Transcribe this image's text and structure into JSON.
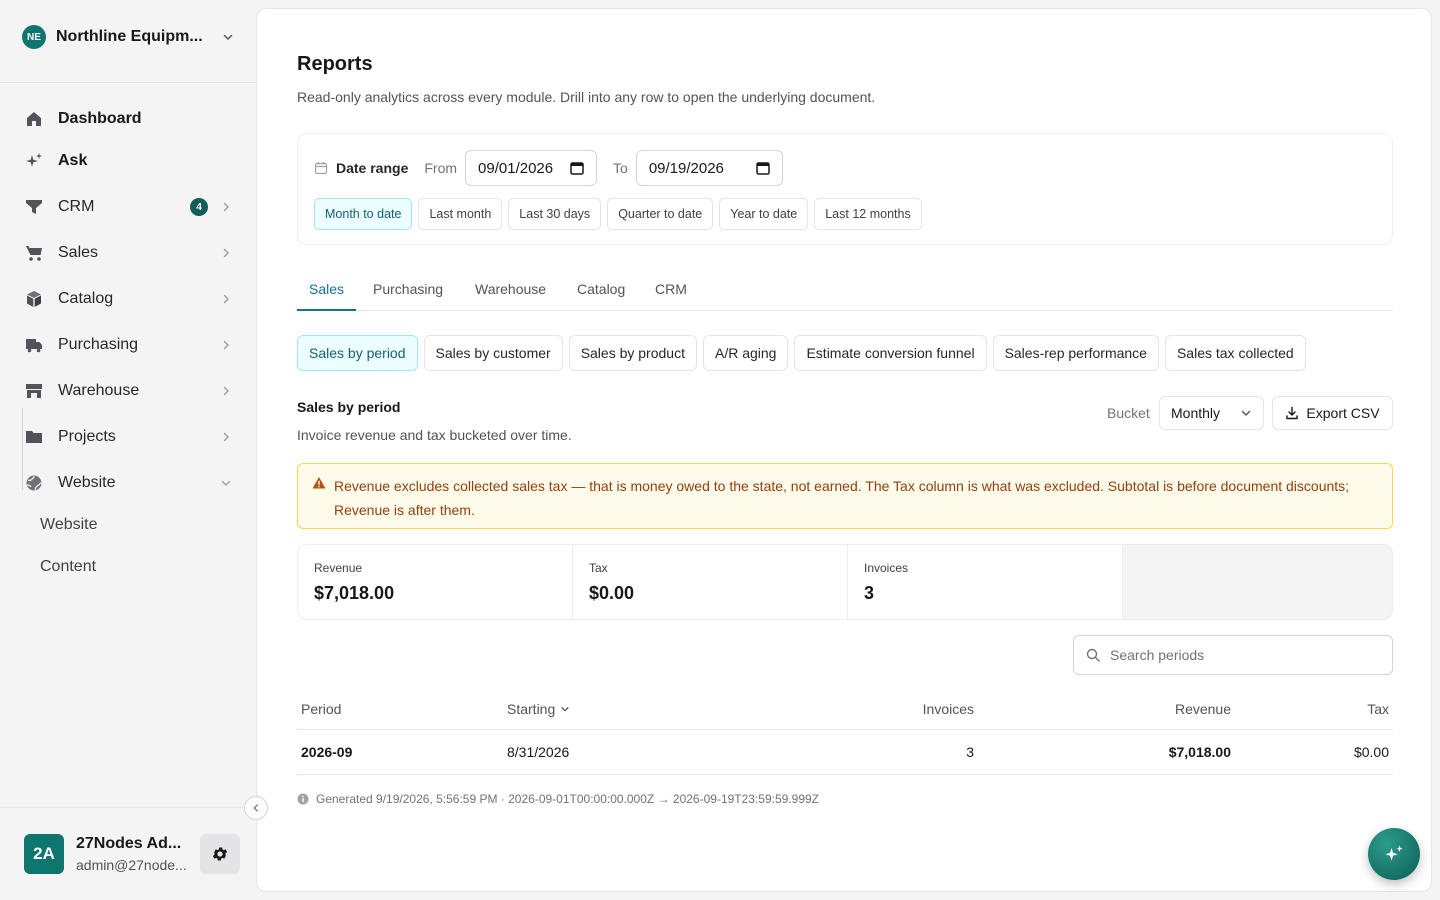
{
  "org": {
    "badge": "NE",
    "name": "Northline Equipm..."
  },
  "nav": {
    "dashboard": "Dashboard",
    "ask": "Ask",
    "crm": "CRM",
    "crm_badge": "4",
    "sales": "Sales",
    "catalog": "Catalog",
    "purchasing": "Purchasing",
    "warehouse": "Warehouse",
    "projects": "Projects",
    "website": "Website",
    "website_sub": [
      "Website",
      "Content"
    ]
  },
  "user": {
    "initials": "2A",
    "name": "27Nodes Ad...",
    "email": "admin@27node..."
  },
  "page": {
    "title": "Reports",
    "subtitle": "Read-only analytics across every module. Drill into any row to open the underlying document."
  },
  "daterange": {
    "label": "Date range",
    "from_label": "From",
    "from_value": "09/01/2026",
    "to_label": "To",
    "to_value": "09/19/2026",
    "presets": [
      "Month to date",
      "Last month",
      "Last 30 days",
      "Quarter to date",
      "Year to date",
      "Last 12 months"
    ]
  },
  "tabs": [
    "Sales",
    "Purchasing",
    "Warehouse",
    "Catalog",
    "CRM"
  ],
  "report_types": [
    "Sales by period",
    "Sales by customer",
    "Sales by product",
    "A/R aging",
    "Estimate conversion funnel",
    "Sales-rep performance",
    "Sales tax collected"
  ],
  "section": {
    "title": "Sales by period",
    "subtitle": "Invoice revenue and tax bucketed over time.",
    "bucket_label": "Bucket",
    "bucket_value": "Monthly",
    "export_label": "Export CSV"
  },
  "warning": "Revenue excludes collected sales tax — that is money owed to the state, not earned. The Tax column is what was excluded. Subtotal is before document discounts; Revenue is after them.",
  "stats": [
    {
      "label": "Revenue",
      "value": "$7,018.00"
    },
    {
      "label": "Tax",
      "value": "$0.00"
    },
    {
      "label": "Invoices",
      "value": "3"
    }
  ],
  "search": {
    "placeholder": "Search periods"
  },
  "table": {
    "headers": {
      "period": "Period",
      "starting": "Starting",
      "invoices": "Invoices",
      "revenue": "Revenue",
      "tax": "Tax"
    },
    "rows": [
      {
        "period": "2026-09",
        "starting": "8/31/2026",
        "invoices": "3",
        "revenue": "$7,018.00",
        "tax": "$0.00"
      }
    ]
  },
  "footnote": "Generated 9/19/2026, 5:56:59 PM · 2026-09-01T00:00:00.000Z → 2026-09-19T23:59:59.999Z",
  "colors": {
    "accent": "#0e7490",
    "brand": "#0f766e",
    "warning_bg": "#fffbeb",
    "warning_text": "#92400e"
  }
}
